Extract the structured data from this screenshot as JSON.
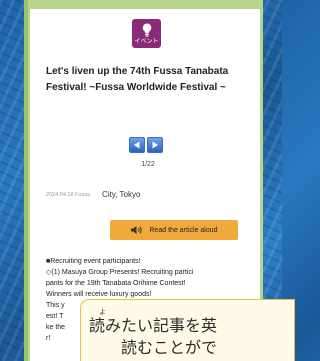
{
  "event_badge": {
    "label": "イベント",
    "icon": "lightbulb-icon",
    "color": "#8a2a78"
  },
  "article": {
    "title": "Let's liven up the 74th Fussa Tanabata Festival! ~Fussa Worldwide Festival ~",
    "date": "2024.04.18 Fussa",
    "location": "City, Tokyo"
  },
  "pager": {
    "current": 1,
    "total": 22,
    "label": "1/22"
  },
  "read_aloud": {
    "label": "Read the article aloud",
    "icon": "speaker-icon",
    "color": "#f2a93b"
  },
  "body_lines": [
    "■Recruiting event participants!",
    "◇(1) Masuya Group Presents! Recruiting partici",
    "pants for the 19th Tanabata Orihime Contest!",
    "Winners will receive luxury goods!",
    "This y",
    "est! T",
    "ke the",
    "r!"
  ],
  "tooltip": {
    "ruby": "よ",
    "line1": "読みたい記事を英",
    "line2": "読むことがで"
  }
}
